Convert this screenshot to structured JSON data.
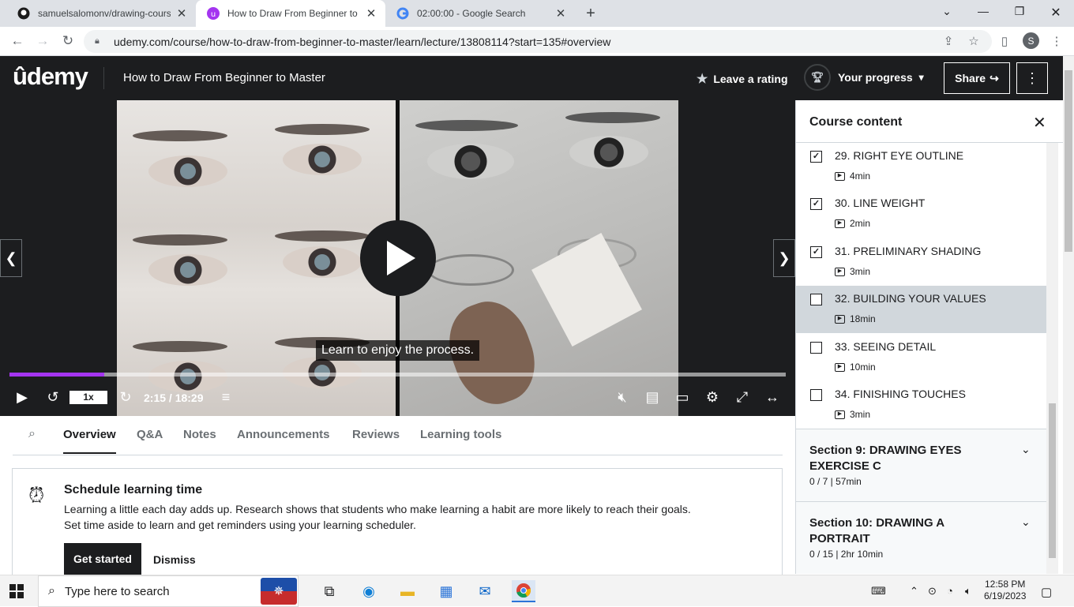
{
  "browser": {
    "tabs": [
      {
        "title": "samuelsalomonv/drawing-course",
        "icon": "github-icon"
      },
      {
        "title": "How to Draw From Beginner to M",
        "icon": "udemy-icon"
      },
      {
        "title": "02:00:00 - Google Search",
        "icon": "google-icon"
      }
    ],
    "url": "udemy.com/course/how-to-draw-from-beginner-to-master/learn/lecture/13808114?start=135#overview",
    "profile_initial": "S"
  },
  "header": {
    "logo": "ûdemy",
    "course_title": "How to Draw From Beginner to Master",
    "rating_label": "Leave a rating",
    "progress_label": "Your progress",
    "share_label": "Share"
  },
  "player": {
    "caption": "Learn to enjoy the process.",
    "playback_rate": "1x",
    "time": "2:15 / 18:29",
    "progress_fraction": 0.122
  },
  "tabs": [
    "Overview",
    "Q&A",
    "Notes",
    "Announcements",
    "Reviews",
    "Learning tools"
  ],
  "schedule": {
    "title": "Schedule learning time",
    "line1": "Learning a little each day adds up. Research shows that students who make learning a habit are more likely to reach their goals.",
    "line2": "Set time aside to learn and get reminders using your learning scheduler.",
    "get_started": "Get started",
    "dismiss": "Dismiss"
  },
  "sidebar": {
    "title": "Course content",
    "lectures": [
      {
        "title": "29. RIGHT EYE OUTLINE",
        "duration": "4min",
        "done": true
      },
      {
        "title": "30. LINE WEIGHT",
        "duration": "2min",
        "done": true
      },
      {
        "title": "31. PRELIMINARY SHADING",
        "duration": "3min",
        "done": true
      },
      {
        "title": "32. BUILDING YOUR VALUES",
        "duration": "18min",
        "done": false
      },
      {
        "title": "33. SEEING DETAIL",
        "duration": "10min",
        "done": false
      },
      {
        "title": "34. FINISHING TOUCHES",
        "duration": "3min",
        "done": false
      }
    ],
    "sections": [
      {
        "title": "Section 9: DRAWING EYES EXERCISE C",
        "stats": "0 / 7 | 57min"
      },
      {
        "title": "Section 10: DRAWING A PORTRAIT",
        "stats": "0 / 15 | 2hr 10min"
      }
    ]
  },
  "taskbar": {
    "search_placeholder": "Type here to search",
    "time": "12:58 PM",
    "date": "6/19/2023"
  },
  "colors": {
    "accent": "#a435f0",
    "dark": "#1c1d1f",
    "current_row": "#d1d7dc"
  }
}
